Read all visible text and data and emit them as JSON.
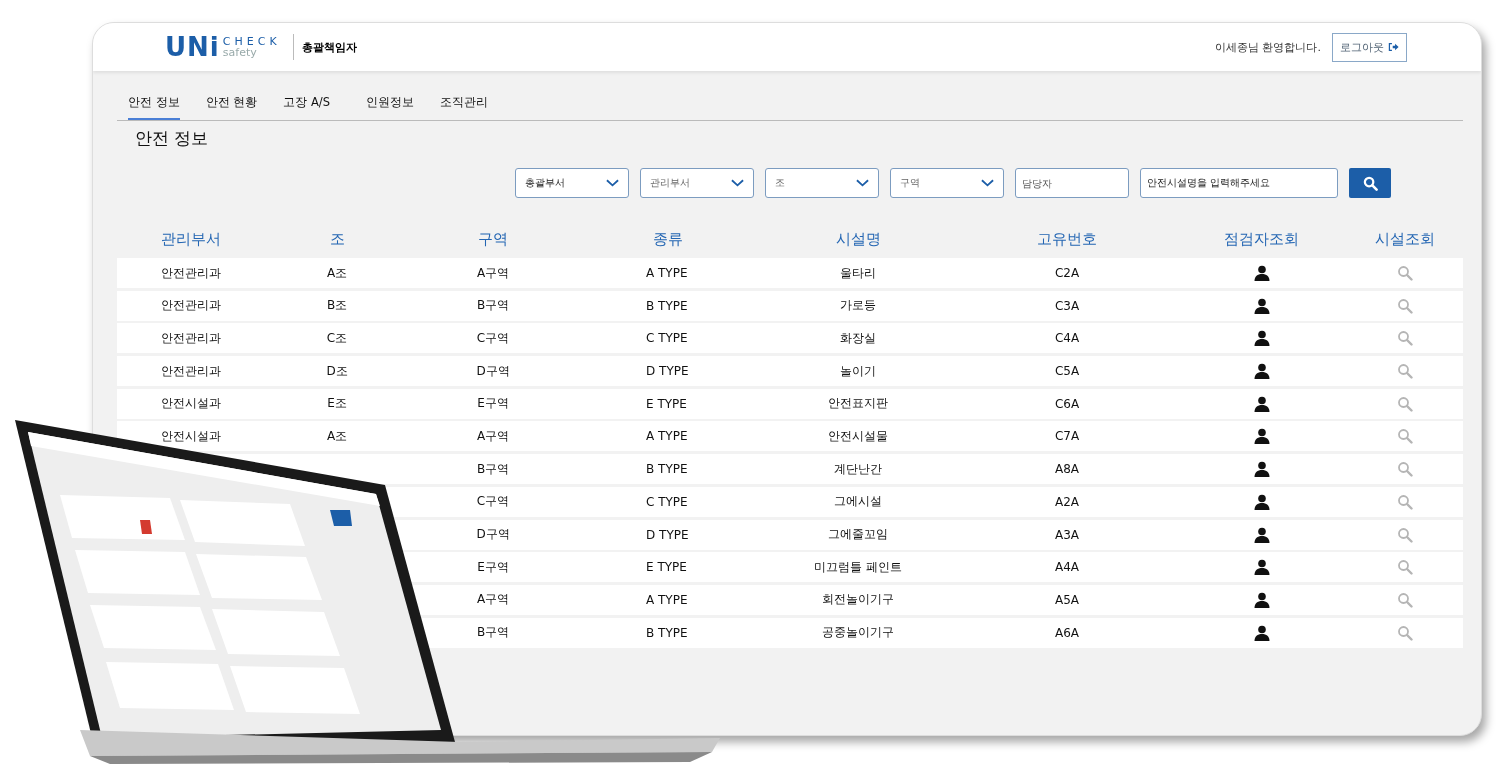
{
  "header": {
    "logo": {
      "main": "UNi",
      "top": "CHECK",
      "sub": "safety"
    },
    "role": "총괄책임자",
    "welcome": "이세종님 환영합니다.",
    "logout": "로그아웃"
  },
  "tabs": [
    {
      "label": "안전 정보",
      "selected": true
    },
    {
      "label": "안전 현황",
      "selected": false
    },
    {
      "label": "고장 A/S",
      "selected": false
    },
    {
      "label": "인원정보",
      "selected": false
    },
    {
      "label": "조직관리",
      "selected": false
    }
  ],
  "page_title": "안전 정보",
  "filters": [
    {
      "kind": "select",
      "value": "총괄부서"
    },
    {
      "kind": "select",
      "placeholder": "관리부서"
    },
    {
      "kind": "select",
      "placeholder": "조"
    },
    {
      "kind": "select",
      "placeholder": "구역"
    },
    {
      "kind": "input",
      "placeholder": "담당자"
    },
    {
      "kind": "input",
      "value": "안전시설명을 입력해주세요"
    }
  ],
  "table": {
    "columns": [
      "관리부서",
      "조",
      "구역",
      "종류",
      "시설명",
      "고유번호",
      "점검자조회",
      "시설조회"
    ],
    "rows": [
      [
        "안전관리과",
        "A조",
        "A구역",
        "A TYPE",
        "울타리",
        "C2A"
      ],
      [
        "안전관리과",
        "B조",
        "B구역",
        "B TYPE",
        "가로등",
        "C3A"
      ],
      [
        "안전관리과",
        "C조",
        "C구역",
        "C TYPE",
        "화장실",
        "C4A"
      ],
      [
        "안전관리과",
        "D조",
        "D구역",
        "D TYPE",
        "놀이기",
        "C5A"
      ],
      [
        "안전시설과",
        "E조",
        "E구역",
        "E TYPE",
        "안전표지판",
        "C6A"
      ],
      [
        "안전시설과",
        "A조",
        "A구역",
        "A TYPE",
        "안전시설물",
        "C7A"
      ],
      [
        null,
        null,
        "B구역",
        "B TYPE",
        "계단난간",
        "A8A"
      ],
      [
        null,
        null,
        "C구역",
        "C TYPE",
        "그에시설",
        "A2A"
      ],
      [
        null,
        null,
        "D구역",
        "D TYPE",
        "그에줄꼬임",
        "A3A"
      ],
      [
        null,
        null,
        "E구역",
        "E TYPE",
        "미끄럼틀 페인트",
        "A4A"
      ],
      [
        null,
        null,
        "A구역",
        "A TYPE",
        "회전놀이기구",
        "A5A"
      ],
      [
        null,
        null,
        "B구역",
        "B TYPE",
        "공중놀이기구",
        "A6A"
      ]
    ]
  }
}
